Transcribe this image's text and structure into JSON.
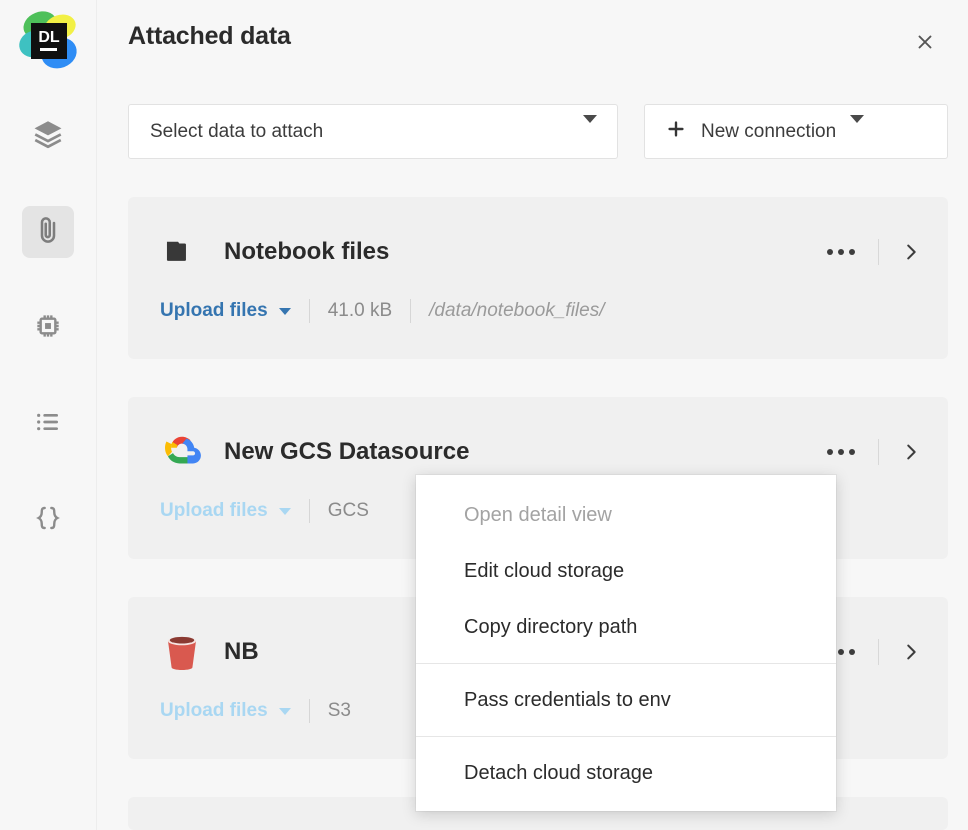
{
  "app": {
    "logo_text": "DL",
    "logo_name": "datalore-logo"
  },
  "sidebar": {
    "items": [
      {
        "icon": "layers-icon",
        "label": "Layers",
        "active": false
      },
      {
        "icon": "paperclip-icon",
        "label": "Attached data",
        "active": true
      },
      {
        "icon": "chip-icon",
        "label": "Compute",
        "active": false
      },
      {
        "icon": "list-icon",
        "label": "Outline",
        "active": false
      },
      {
        "icon": "braces-icon",
        "label": "Variables",
        "active": false
      }
    ]
  },
  "header": {
    "title": "Attached data",
    "close_icon": "close-icon"
  },
  "toolbar": {
    "select_data_label": "Select data to attach",
    "new_connection_label": "New connection",
    "plus_icon": "plus-icon",
    "caret_icon": "chevron-down-icon"
  },
  "cards": [
    {
      "icon": "folder-icon",
      "name": "Notebook files",
      "upload_label": "Upload files",
      "size": "41.0 kB",
      "path": "/data/notebook_files/",
      "faded": false,
      "more_icon": "more-icon",
      "expand_icon": "chevron-right-icon"
    },
    {
      "icon": "google-cloud-icon",
      "name": "New GCS Datasource",
      "upload_label": "Upload files",
      "size": "GCS",
      "path": "",
      "faded": true,
      "more_icon": "more-icon",
      "expand_icon": "chevron-right-icon"
    },
    {
      "icon": "s3-bucket-icon",
      "name": "NB",
      "upload_label": "Upload files",
      "size": "S3",
      "path": "",
      "faded": true,
      "more_icon": "more-icon",
      "expand_icon": "chevron-right-icon"
    }
  ],
  "context_menu": {
    "items": [
      {
        "label": "Open detail view",
        "disabled": true,
        "separator_after": false
      },
      {
        "label": "Edit cloud storage",
        "disabled": false,
        "separator_after": false
      },
      {
        "label": "Copy directory path",
        "disabled": false,
        "separator_after": true
      },
      {
        "label": "Pass credentials to env",
        "disabled": false,
        "separator_after": true
      },
      {
        "label": "Detach cloud storage",
        "disabled": false,
        "separator_after": false
      }
    ]
  },
  "colors": {
    "page_bg": "#f7f7f7",
    "card_bg": "#f0f0f0",
    "link_blue": "#3575b0",
    "link_blue_faded": "#a9d7f2",
    "text_primary": "#2b2b2b",
    "text_muted": "#8b8b8b"
  }
}
